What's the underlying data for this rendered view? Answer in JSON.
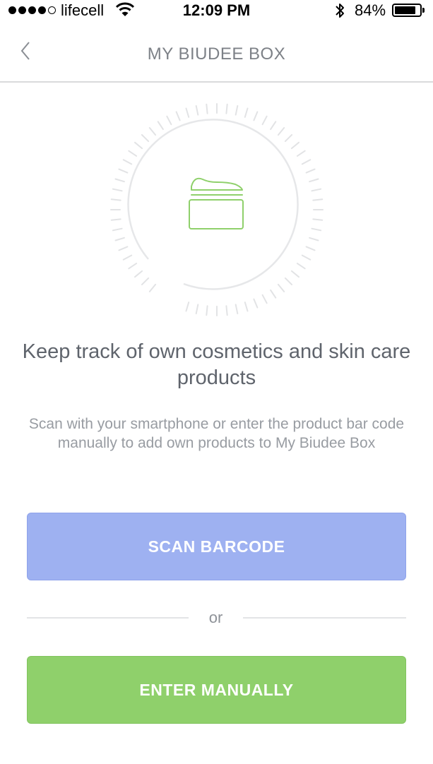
{
  "status_bar": {
    "carrier": "lifecell",
    "time": "12:09 PM",
    "battery_percent": "84%",
    "battery_level": 0.84,
    "signal_bars_filled": 4,
    "signal_bars_total": 5
  },
  "nav": {
    "title": "MY BIUDEE BOX",
    "back_icon": "chevron-left-icon"
  },
  "illustration": {
    "icon": "cream-jar-icon",
    "accent_color": "#8fd06b"
  },
  "main": {
    "headline": "Keep track of own cosmetics and skin care products",
    "description": "Scan with your smartphone or enter the product bar code manually to add own products to My Biudee Box"
  },
  "actions": {
    "scan_label": "SCAN BARCODE",
    "scan_color": "#9eb1f1",
    "or_label": "or",
    "manual_label": "ENTER MANUALLY",
    "manual_color": "#8fd06b"
  }
}
